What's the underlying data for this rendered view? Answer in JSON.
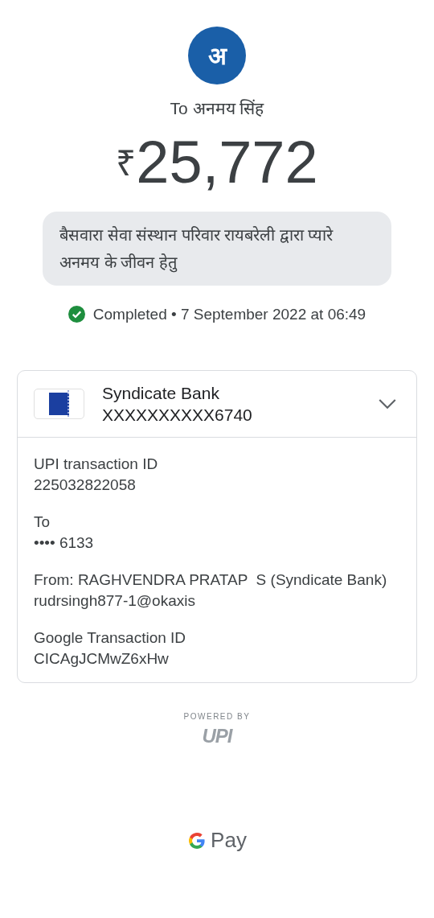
{
  "payee": {
    "avatar_letter": "अ",
    "to_label": "To अनमय सिंह"
  },
  "amount": {
    "currency": "₹",
    "value": "25,772"
  },
  "message": "बैसवारा सेवा संस्थान परिवार रायबरेली द्वारा प्यारे अनमय के जीवन हेतु",
  "status": {
    "text": "Completed",
    "separator": "•",
    "datetime": "7 September 2022 at 06:49"
  },
  "account": {
    "bank": "Syndicate Bank",
    "number": "XXXXXXXXXX6740",
    "expanded": false
  },
  "details": [
    {
      "label": "UPI transaction ID",
      "value": "225032822058"
    },
    {
      "label": "To",
      "value": "•••• 6133"
    },
    {
      "label": "From: RAGHVENDRA PRATAP  S (Syndicate Bank)",
      "value": "rudrsingh877-1@okaxis"
    },
    {
      "label": "Google Transaction ID",
      "value": "CICAgJCMwZ6xHw"
    }
  ],
  "powered_by": {
    "label": "POWERED BY",
    "logo_text": "UPI"
  },
  "footer": {
    "brand_text": "Pay"
  }
}
